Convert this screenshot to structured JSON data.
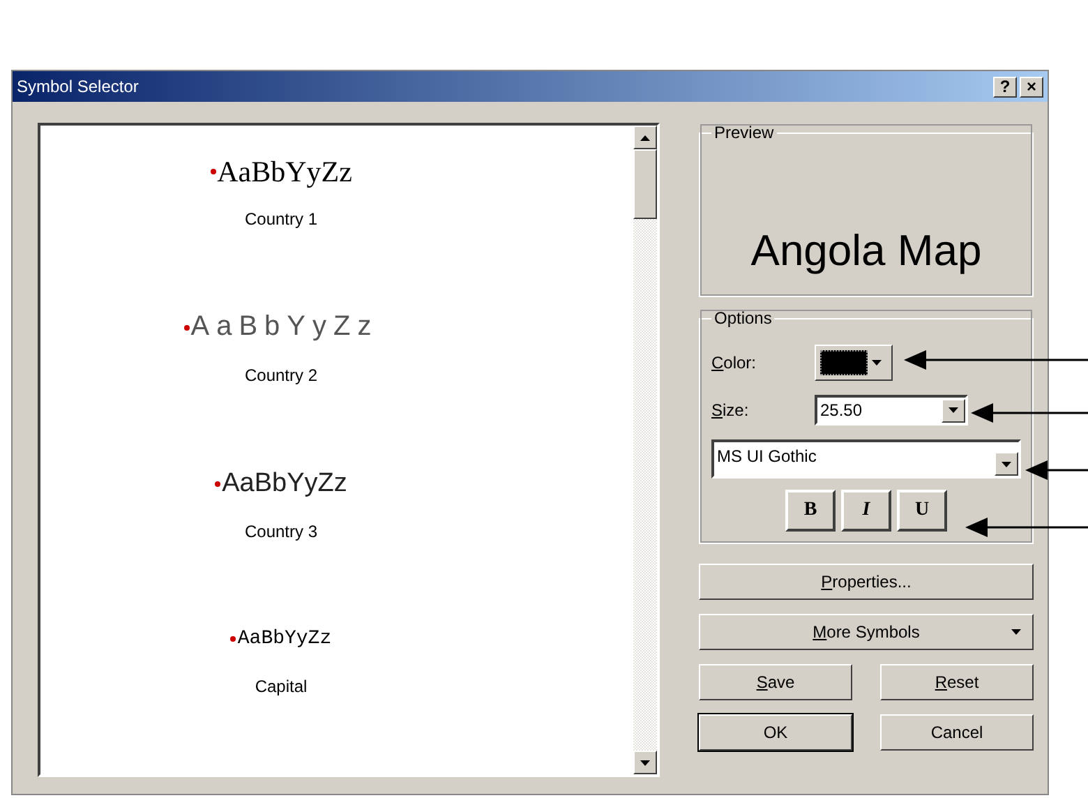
{
  "window": {
    "title": "Symbol Selector",
    "buttons": [
      "?",
      "×"
    ]
  },
  "symbols": [
    {
      "kind": "serif",
      "sample": "AaBbYyZz",
      "label": "Country 1"
    },
    {
      "kind": "wide",
      "sample": "AaBbYyZz",
      "label": "Country 2"
    },
    {
      "kind": "sans",
      "sample": "AaBbYyZz",
      "label": "Country 3"
    },
    {
      "kind": "mono",
      "sample": "AaBbYyZz",
      "label": "Capital"
    }
  ],
  "preview": {
    "title": "Preview",
    "text": "Angola Map"
  },
  "options": {
    "title": "Options",
    "color_label": "Color:",
    "color": "#000000",
    "size_label": "Size:",
    "size": "25.50",
    "font": "MS UI Gothic",
    "styles": [
      "B",
      "I",
      "U"
    ]
  },
  "buttons": [
    {
      "kind": "wide",
      "label": "Properties...",
      "underlined_first": true
    },
    {
      "kind": "menu",
      "label": "More Symbols",
      "underlined_first": true
    },
    {
      "kind": "half",
      "label": "Save",
      "underlined_first": true
    },
    {
      "kind": "half",
      "label": "Reset",
      "underlined_first": true
    },
    {
      "kind": "default",
      "label": "OK",
      "underlined_first": false
    },
    {
      "kind": "half",
      "label": "Cancel",
      "underlined_first": false
    }
  ]
}
